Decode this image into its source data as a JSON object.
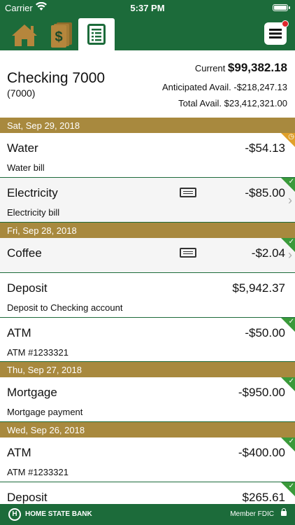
{
  "status": {
    "carrier": "Carrier",
    "time": "5:37 PM",
    "battery_level": 1.0
  },
  "nav": {
    "tabs": [
      {
        "icon": "home-icon",
        "active": false
      },
      {
        "icon": "dollar-cards-icon",
        "active": false
      },
      {
        "icon": "register-icon",
        "active": true
      }
    ],
    "menu_icon": "hamburger-menu-icon",
    "has_notification": true
  },
  "account": {
    "name": "Checking 7000",
    "number": "(7000)",
    "current_label": "Current",
    "current_amount": "$99,382.18",
    "anticipated": "Anticipated Avail. -$218,247.13",
    "total": "Total Avail. $23,412,321.00"
  },
  "dates": [
    "Sat, Sep 29, 2018",
    "Fri, Sep 28, 2018",
    "Thu, Sep 27, 2018",
    "Wed, Sep 26, 2018"
  ],
  "transactions": [
    {
      "title": "Water",
      "amount": "-$54.13",
      "desc": "Water bill",
      "status": "pending"
    },
    {
      "title": "Electricity",
      "amount": "-$85.00",
      "desc": "Electricity bill",
      "status": "cleared",
      "receipt": true
    },
    {
      "title": "Coffee",
      "amount": "-$2.04",
      "desc": "",
      "status": "cleared",
      "receipt": true
    },
    {
      "title": "Deposit",
      "amount": "$5,942.37",
      "desc": "Deposit to Checking account",
      "status": "cleared"
    },
    {
      "title": "ATM",
      "amount": "-$50.00",
      "desc": "ATM #1233321",
      "status": "cleared"
    },
    {
      "title": "Mortgage",
      "amount": "-$950.00",
      "desc": "Mortgage payment",
      "status": "cleared"
    },
    {
      "title": "ATM",
      "amount": "-$400.00",
      "desc": "ATM #1233321",
      "status": "cleared"
    },
    {
      "title": "Deposit",
      "amount": "$265.61",
      "desc": "",
      "status": "cleared"
    }
  ],
  "footer": {
    "bank_name": "HOME STATE BANK",
    "fdic": "Member FDIC"
  },
  "colors": {
    "brand_green": "#1c6b3a",
    "date_gold": "#a8893e",
    "cleared": "#3a9a3a",
    "pending": "#e0a02a",
    "notification": "#e0262d"
  }
}
